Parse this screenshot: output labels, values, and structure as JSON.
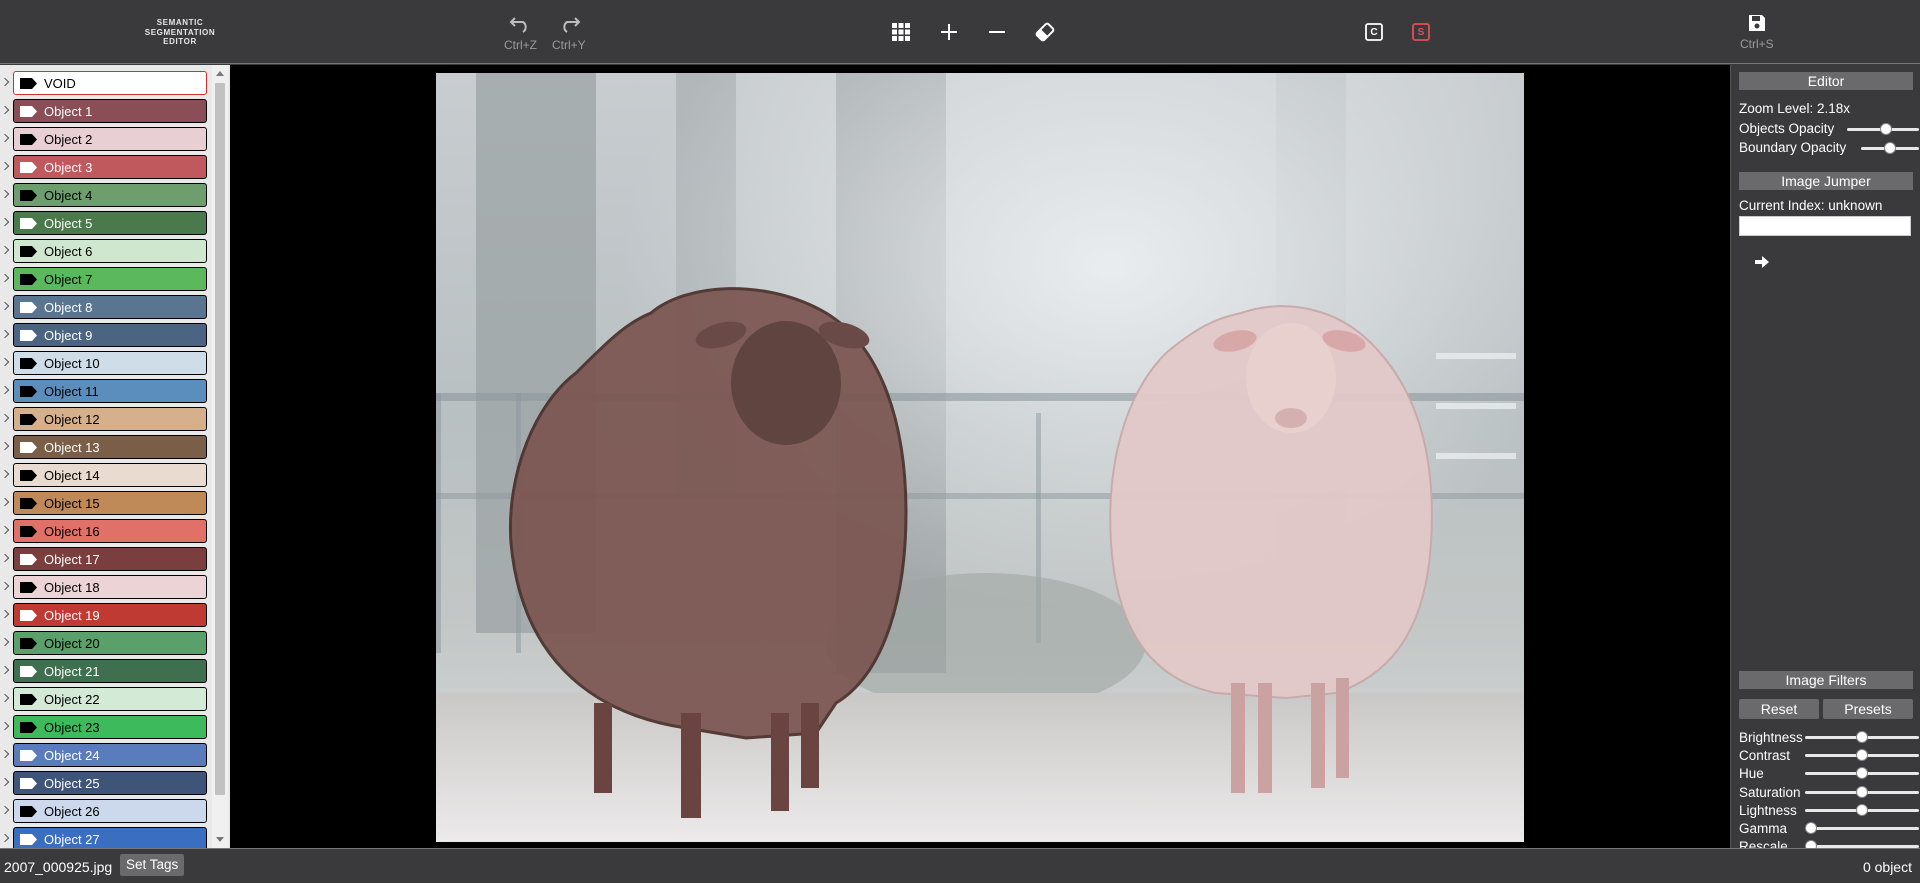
{
  "app": {
    "logo_lines": [
      "SEMANTIC",
      "SEGMENTATION",
      "EDITOR"
    ]
  },
  "toolbar": {
    "undo_shortcut": "Ctrl+Z",
    "redo_shortcut": "Ctrl+Y",
    "save_shortcut": "Ctrl+S",
    "c_label": "C",
    "s_label": "S",
    "s_color": "#e05050"
  },
  "objects": [
    {
      "label": "VOID",
      "color": "#ffffff",
      "text": "#000000",
      "tag": "#000000",
      "void": true
    },
    {
      "label": "Object 1",
      "color": "#8a4e56",
      "text": "#ffffff",
      "tag": "#ffffff"
    },
    {
      "label": "Object 2",
      "color": "#e8cfd3",
      "text": "#000000",
      "tag": "#000000"
    },
    {
      "label": "Object 3",
      "color": "#c0595d",
      "text": "#ffffff",
      "tag": "#ffffff"
    },
    {
      "label": "Object 4",
      "color": "#6e9e6e",
      "text": "#000000",
      "tag": "#000000"
    },
    {
      "label": "Object 5",
      "color": "#4a7a4c",
      "text": "#ffffff",
      "tag": "#ffffff"
    },
    {
      "label": "Object 6",
      "color": "#cfe6cf",
      "text": "#000000",
      "tag": "#000000"
    },
    {
      "label": "Object 7",
      "color": "#5cb85c",
      "text": "#000000",
      "tag": "#000000"
    },
    {
      "label": "Object 8",
      "color": "#5a7590",
      "text": "#ffffff",
      "tag": "#ffffff"
    },
    {
      "label": "Object 9",
      "color": "#4a6482",
      "text": "#ffffff",
      "tag": "#ffffff"
    },
    {
      "label": "Object 10",
      "color": "#cfdde8",
      "text": "#000000",
      "tag": "#000000"
    },
    {
      "label": "Object 11",
      "color": "#5b8ebd",
      "text": "#000000",
      "tag": "#000000"
    },
    {
      "label": "Object 12",
      "color": "#d6b08c",
      "text": "#000000",
      "tag": "#000000"
    },
    {
      "label": "Object 13",
      "color": "#7a5e48",
      "text": "#ffffff",
      "tag": "#ffffff"
    },
    {
      "label": "Object 14",
      "color": "#eadbd0",
      "text": "#000000",
      "tag": "#000000"
    },
    {
      "label": "Object 15",
      "color": "#c08a58",
      "text": "#000000",
      "tag": "#000000"
    },
    {
      "label": "Object 16",
      "color": "#e07068",
      "text": "#000000",
      "tag": "#000000"
    },
    {
      "label": "Object 17",
      "color": "#7a3e3e",
      "text": "#ffffff",
      "tag": "#ffffff"
    },
    {
      "label": "Object 18",
      "color": "#ecd4d6",
      "text": "#000000",
      "tag": "#000000"
    },
    {
      "label": "Object 19",
      "color": "#c03a34",
      "text": "#ffffff",
      "tag": "#ffffff"
    },
    {
      "label": "Object 20",
      "color": "#5aa06a",
      "text": "#000000",
      "tag": "#000000"
    },
    {
      "label": "Object 21",
      "color": "#3e7050",
      "text": "#ffffff",
      "tag": "#ffffff"
    },
    {
      "label": "Object 22",
      "color": "#d2ead6",
      "text": "#000000",
      "tag": "#000000"
    },
    {
      "label": "Object 23",
      "color": "#3cba5c",
      "text": "#000000",
      "tag": "#000000"
    },
    {
      "label": "Object 24",
      "color": "#5a7cbc",
      "text": "#ffffff",
      "tag": "#ffffff"
    },
    {
      "label": "Object 25",
      "color": "#3e5478",
      "text": "#ffffff",
      "tag": "#ffffff"
    },
    {
      "label": "Object 26",
      "color": "#ccd8ec",
      "text": "#000000",
      "tag": "#000000"
    },
    {
      "label": "Object 27",
      "color": "#3a6ec0",
      "text": "#ffffff",
      "tag": "#ffffff"
    }
  ],
  "editor": {
    "header": "Editor",
    "zoom_level": "Zoom Level: 2.18x",
    "objects_opacity_label": "Objects Opacity",
    "objects_opacity": 0.55,
    "boundary_opacity_label": "Boundary Opacity",
    "boundary_opacity": 0.5
  },
  "jumper": {
    "header": "Image Jumper",
    "current_index": "Current Index: unknown",
    "input_value": ""
  },
  "filters": {
    "header": "Image Filters",
    "reset_label": "Reset",
    "presets_label": "Presets",
    "sliders": [
      {
        "label": "Brightness",
        "value": 0.5
      },
      {
        "label": "Contrast",
        "value": 0.5
      },
      {
        "label": "Hue",
        "value": 0.5
      },
      {
        "label": "Saturation",
        "value": 0.5
      },
      {
        "label": "Lightness",
        "value": 0.5
      },
      {
        "label": "Gamma",
        "value": 0.0
      },
      {
        "label": "Rescale",
        "value": 0.0
      }
    ]
  },
  "status": {
    "filename": "2007_000925.jpg",
    "set_tags_label": "Set Tags",
    "object_count": "0 object"
  }
}
